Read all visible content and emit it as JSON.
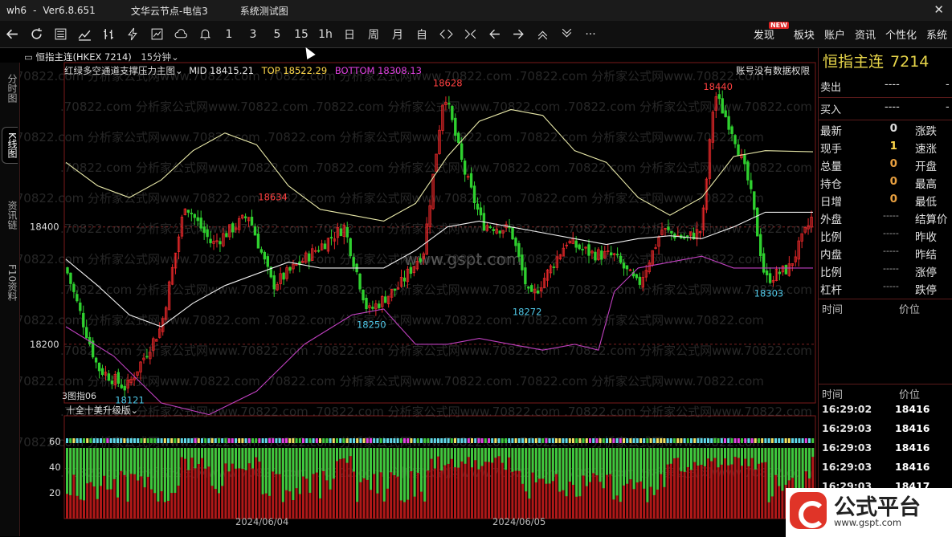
{
  "titlebar": {
    "app": "wh6",
    "sep": "-",
    "version": "Ver6.8.651",
    "server": "文华云节点-电信3",
    "system": "系统测试图",
    "close": "✕"
  },
  "toolbar": {
    "icons": [
      "back-icon",
      "refresh-icon",
      "list-icon",
      "line-chart-icon",
      "ohlc-icon",
      "lightning-icon",
      "grid-chart-icon",
      "cloud-icon",
      "bell-icon"
    ],
    "periods": [
      "1",
      "3",
      "5",
      "15",
      "1h",
      "日",
      "周",
      "月",
      "自"
    ],
    "more": "···",
    "menus": [
      "发现",
      "板块",
      "账户",
      "资讯",
      "个性化",
      "系统"
    ],
    "new_badge": "NEW"
  },
  "left_tabs": [
    "分时图",
    "K线图",
    "资讯链",
    "F10资料"
  ],
  "chart": {
    "symbol": "恒指主连(HKEX 7214)",
    "period": "15分钟",
    "indicator": "红绿多空通道支撑压力主图",
    "mid_label": "MID 18415.21",
    "top_label": "TOP 18522.29",
    "bottom_label": "BOTTOM 18308.13",
    "notice": "账号没有数据权限",
    "y_axis": [
      "18400",
      "18200"
    ],
    "sub_indicator": "十全十美升级版",
    "sub_y_axis": [
      "60",
      "40",
      "20"
    ],
    "sub_prefix": "3图指06",
    "x_dates": [
      "2024/06/04",
      "2024/06/05"
    ],
    "annotations": [
      "18634",
      "18628",
      "18440",
      "18250",
      "18272",
      "18303",
      "18121"
    ],
    "watermark": ".70822.com 分析家公式网www.70822.com",
    "center_watermark": "www.gspt.com"
  },
  "chart_data": {
    "type": "candlestick",
    "y_range": [
      18100,
      18680
    ],
    "series": [
      {
        "name": "MID",
        "value": 18415.21
      },
      {
        "name": "TOP",
        "value": 18522.29
      },
      {
        "name": "BOTTOM",
        "value": 18308.13
      }
    ],
    "marked_extremes": [
      18634,
      18628,
      18440,
      18250,
      18272,
      18303,
      18121
    ]
  },
  "right_panel": {
    "name": "恒指主连",
    "code": "7214",
    "sell": {
      "label": "卖出",
      "v1": "----",
      "v2": "-"
    },
    "buy": {
      "label": "买入",
      "v1": "----",
      "v2": "-"
    },
    "quotes": [
      {
        "k": "最新",
        "n": "0",
        "k2": "涨跌",
        "c": ""
      },
      {
        "k": "现手",
        "n": "1",
        "k2": "速涨",
        "c": "y"
      },
      {
        "k": "总量",
        "n": "0",
        "k2": "开盘",
        "c": "o"
      },
      {
        "k": "持仓",
        "n": "0",
        "k2": "最高",
        "c": "o"
      },
      {
        "k": "日增",
        "n": "0",
        "k2": "最低",
        "c": "o"
      }
    ],
    "dash_rows": [
      {
        "k": "外盘",
        "d": "-----",
        "k2": "结算价"
      },
      {
        "k": "比例",
        "d": "-----",
        "k2": "昨收"
      },
      {
        "k": "内盘",
        "d": "-----",
        "k2": "昨结"
      },
      {
        "k": "比例",
        "d": "-----",
        "k2": "涨停"
      },
      {
        "k": "杠杆",
        "d": "-----",
        "k2": "跌停"
      }
    ],
    "section1": {
      "a": "时间",
      "b": "价位"
    },
    "section2": {
      "a": "时间",
      "b": "价位"
    },
    "ticks": [
      {
        "t": "16:29:02",
        "p": "18416"
      },
      {
        "t": "16:29:03",
        "p": "18416"
      },
      {
        "t": "16:29:03",
        "p": "18416"
      },
      {
        "t": "16:29:03",
        "p": "18416"
      },
      {
        "t": "16:29:03",
        "p": "18417"
      }
    ]
  },
  "logo": {
    "text": "公式平台",
    "url": "www.gspt.com"
  }
}
